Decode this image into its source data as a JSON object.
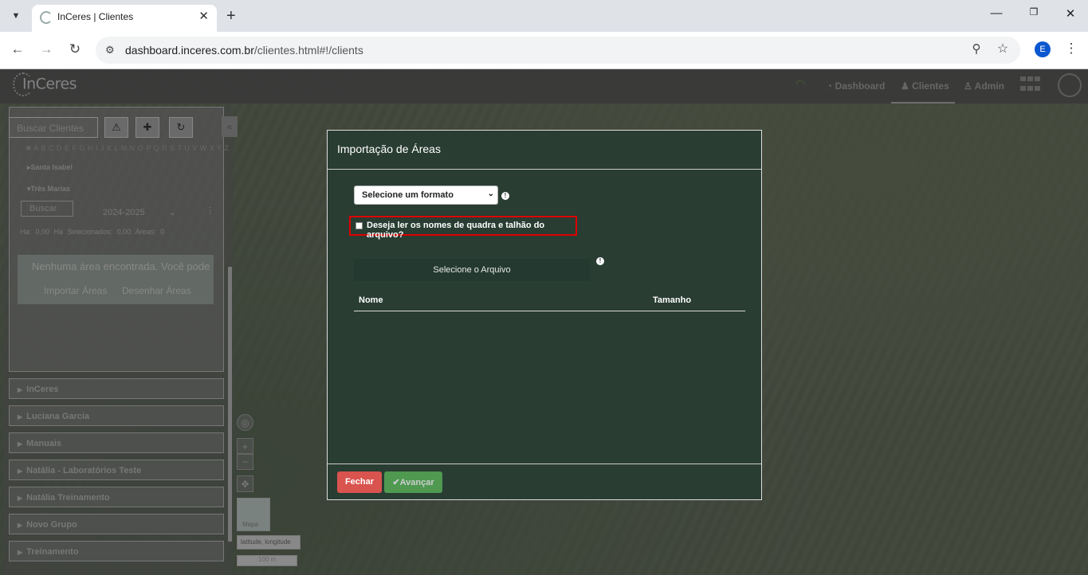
{
  "browser": {
    "tab_title": "InCeres | Clientes",
    "url_host": "dashboard.inceres.com.br",
    "url_path": "/clientes.html#!/clients",
    "profile_initial": "E"
  },
  "app": {
    "logo": "InCeres",
    "nav": {
      "dashboard": "Dashboard",
      "clients": "Clientes",
      "admin": "Admin"
    }
  },
  "sidebar": {
    "search_placeholder": "Buscar Clientes",
    "alphabet": "✖ A B C D E F G H I J K L M N O P Q R S T U V W X Y Z",
    "farm_1": "Santa Isabel",
    "farm_2": "Três Marias",
    "filter_placeholder": "Buscar",
    "season": "2024-2025",
    "stats": "Ha: 0,00   Ha Selecionados: 0,00   Áreas: 0",
    "empty_msg": "Nenhuma área encontrada. Você pode",
    "import_areas": "Importar Áreas",
    "draw_areas": "Desenhar Áreas",
    "groups": [
      "InCeres",
      "Luciana Garcia",
      "Manuais",
      "Natália - Laboratórios Teste",
      "Natália Treinamento",
      "Novo Grupo",
      "Treinamento"
    ]
  },
  "map": {
    "thumb_label": "Mapa",
    "coords": "latitude, longitude",
    "scale": "100 m"
  },
  "modal": {
    "title": "Importação de Áreas",
    "format_select": "Selecione um formato",
    "checkbox_label": "Deseja ler os nomes de quadra e talhão do arquivo?",
    "file_button": "Selecione o Arquivo",
    "col_name": "Nome",
    "col_size": "Tamanho",
    "close_button": "Fechar",
    "next_button": "Avançar"
  },
  "colors": {
    "modal_bg": "#293d33",
    "close": "#d9534f",
    "next": "#5cb85c",
    "highlight": "#dd0000"
  }
}
